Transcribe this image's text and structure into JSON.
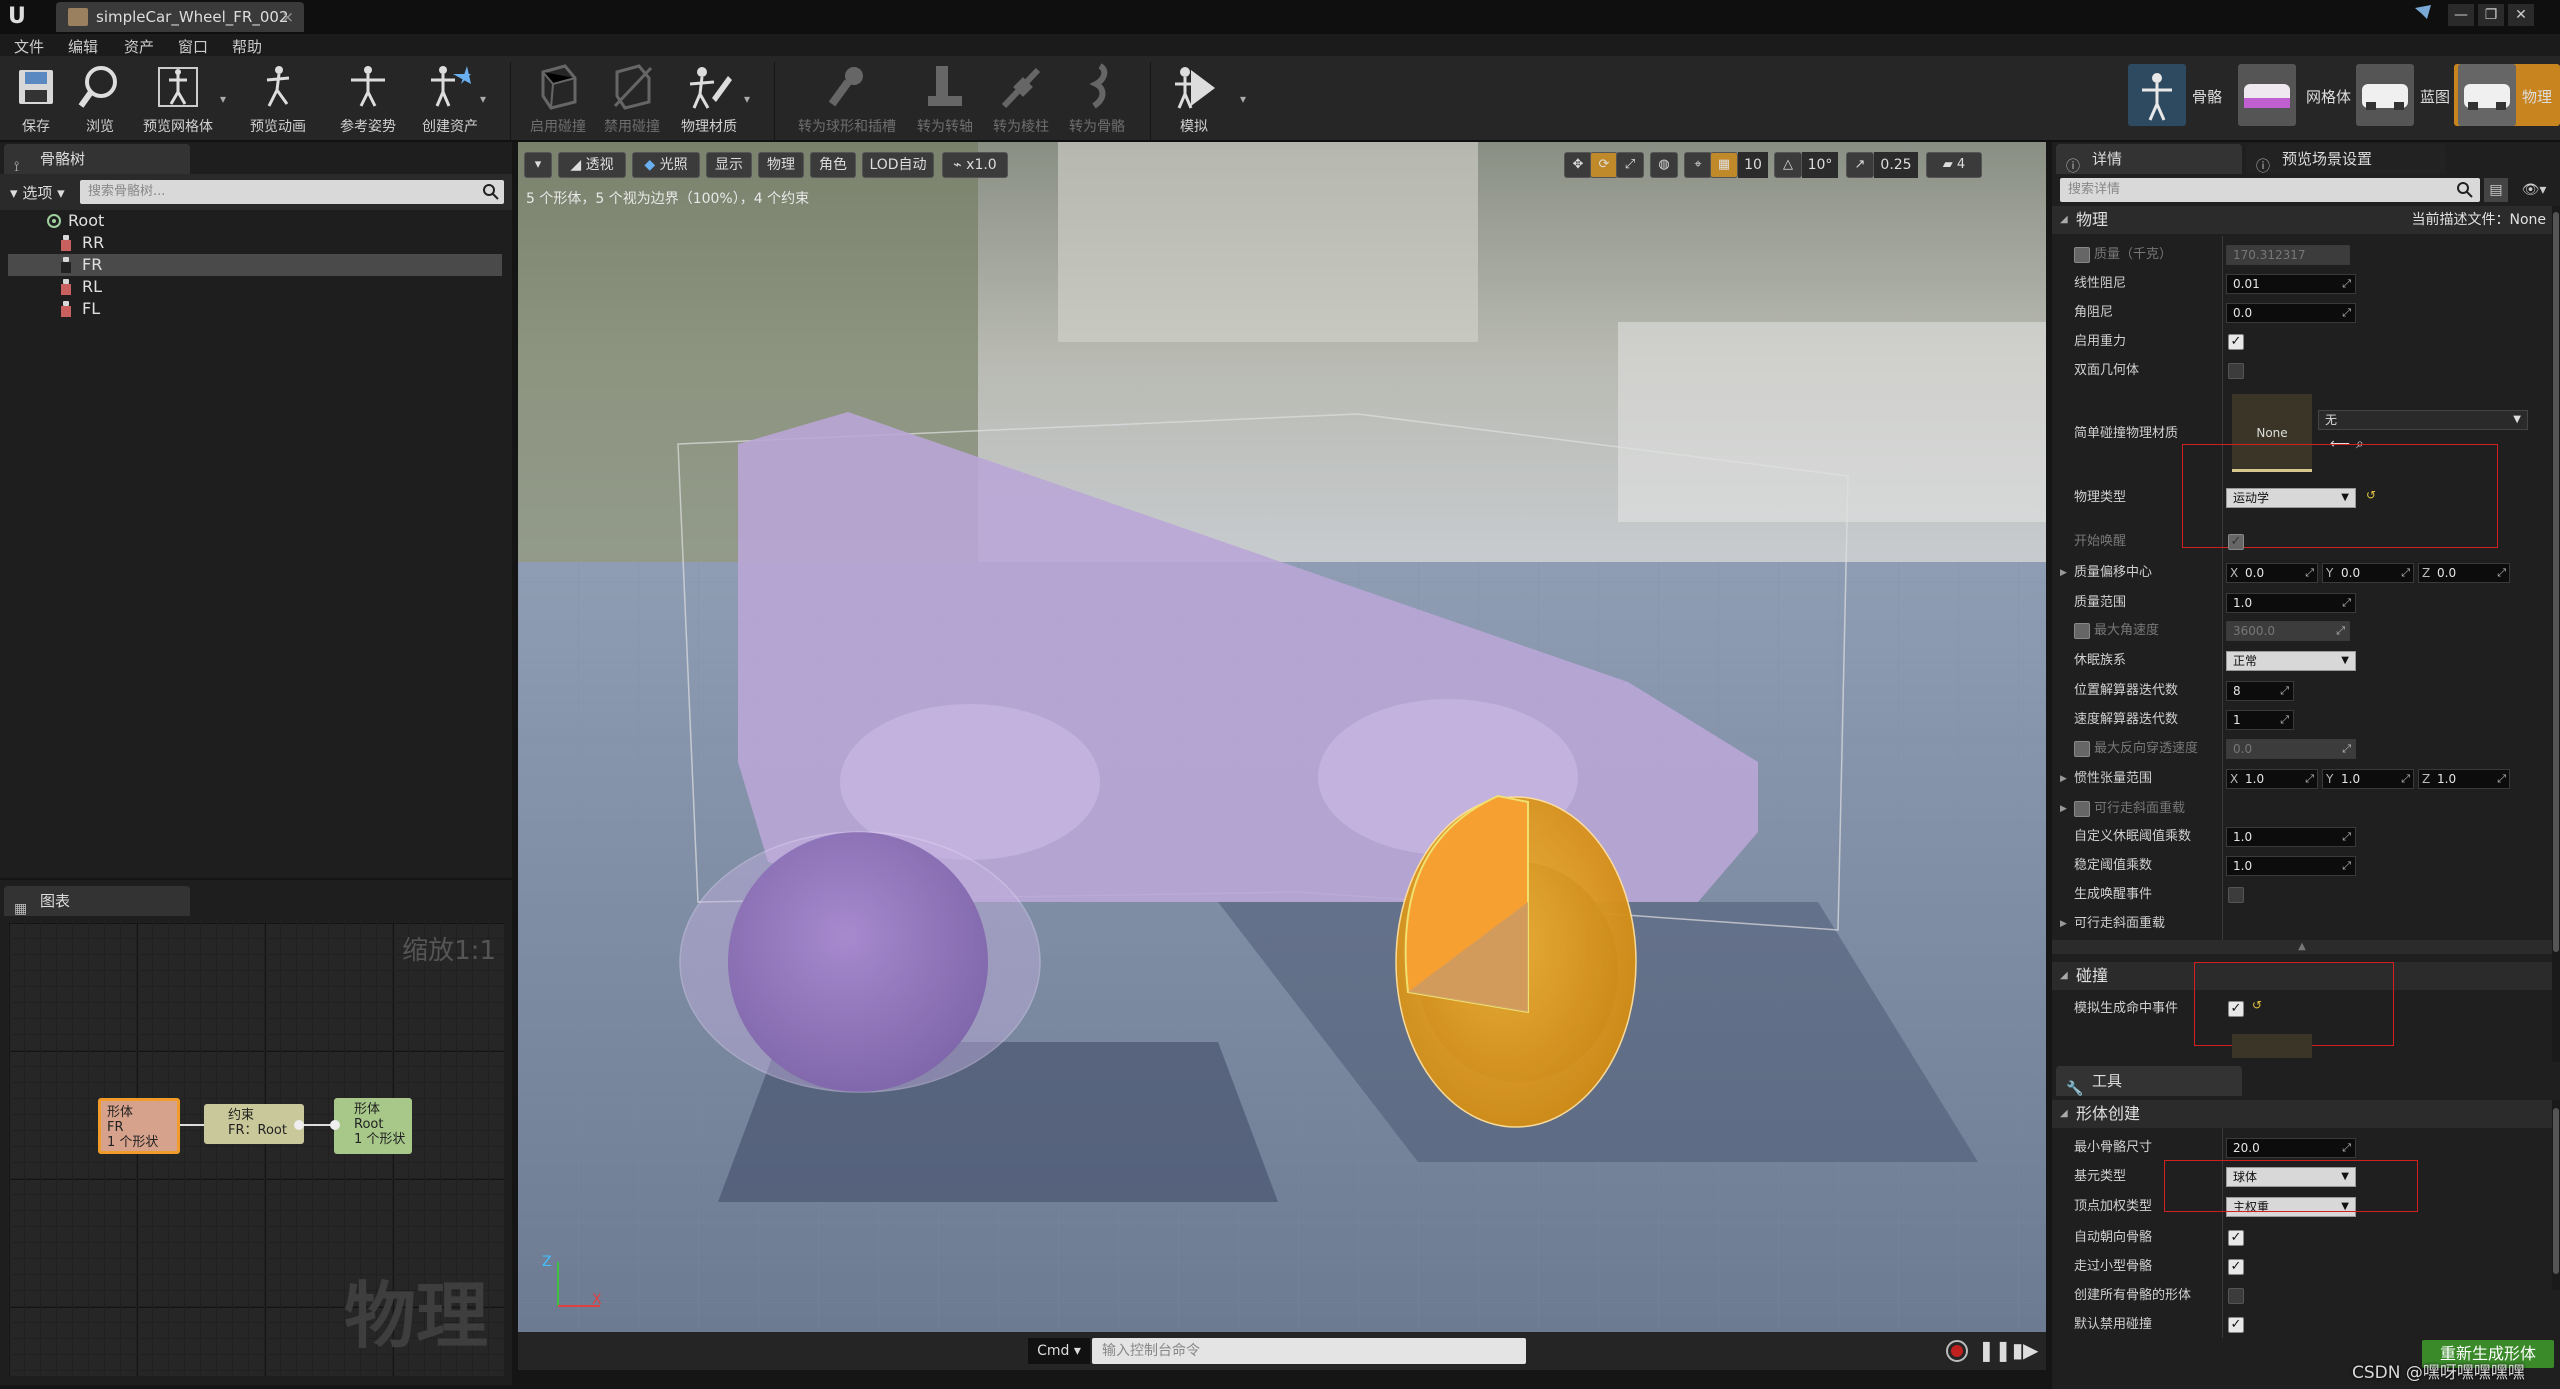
{
  "window": {
    "logo": "U",
    "tab_title": "simpleCar_Wheel_FR_002",
    "tab_close": "×",
    "controls": [
      "—",
      "❐",
      "✕"
    ]
  },
  "menu": [
    "文件",
    "编辑",
    "资产",
    "窗口",
    "帮助"
  ],
  "toolbar": {
    "buttons": [
      {
        "label": "保存",
        "icon": "save-icon"
      },
      {
        "label": "浏览",
        "icon": "browse-icon"
      },
      {
        "label": "预览网格体",
        "icon": "preview-mesh-icon"
      },
      {
        "label": "预览动画",
        "icon": "preview-animation-icon"
      },
      {
        "label": "参考姿势",
        "icon": "reference-pose-icon"
      },
      {
        "label": "创建资产",
        "icon": "create-asset-icon"
      },
      {
        "label": "启用碰撞",
        "icon": "enable-collision-icon"
      },
      {
        "label": "禁用碰撞",
        "icon": "disable-collision-icon"
      },
      {
        "label": "物理材质",
        "icon": "physical-material-icon"
      },
      {
        "label": "转为球形和插槽",
        "icon": "convert-to-ballsocket-icon"
      },
      {
        "label": "转为转轴",
        "icon": "convert-to-hinge-icon"
      },
      {
        "label": "转为棱柱",
        "icon": "convert-to-prismatic-icon"
      },
      {
        "label": "转为骨骼",
        "icon": "convert-to-skeletal-icon"
      },
      {
        "label": "模拟",
        "icon": "simulate-icon"
      }
    ],
    "modes": [
      {
        "label": "骨骼",
        "icon": "skeleton-mode-icon"
      },
      {
        "label": "网格体",
        "icon": "mesh-mode-icon"
      },
      {
        "label": "蓝图",
        "icon": "blueprint-mode-icon"
      },
      {
        "label": "物理",
        "icon": "physics-mode-icon"
      }
    ]
  },
  "skeleton_tree": {
    "tab": "骨骼树",
    "options_label": "选项",
    "search_placeholder": "搜索骨骼树...",
    "root": "Root",
    "bones": [
      "RR",
      "FR",
      "RL",
      "FL"
    ],
    "selected": "FR"
  },
  "graph": {
    "tab": "图表",
    "zoom_label": "缩放1:1",
    "watermark": "物理",
    "nodes": [
      {
        "line1": "形体",
        "line2": "FR",
        "line3": "1 个形状"
      },
      {
        "line1": "约束",
        "line2": "FR：Root",
        "line3": ""
      },
      {
        "line1": "形体",
        "line2": "Root",
        "line3": "1 个形状"
      }
    ]
  },
  "viewport": {
    "buttons": [
      "透视",
      "光照",
      "显示",
      "物理",
      "角色",
      "LOD自动",
      "x1.0"
    ],
    "stats": "5 个形体，5 个视为边界（100%），4 个约束",
    "grid_snap": "10",
    "rotation_snap": "10°",
    "scale_snap": "0.25",
    "camera_speed": "4",
    "console_label": "Cmd",
    "console_placeholder": "输入控制台命令",
    "axis_z": "Z",
    "axis_x": "X"
  },
  "details": {
    "tab1": "详情",
    "tab2": "预览场景设置",
    "search_placeholder": "搜索详情",
    "physics_section": "物理",
    "profile_label": "当前描述文件：None",
    "mass_label": "质量（千克）",
    "mass_value": "170.312317",
    "linear_damping_label": "线性阻尼",
    "linear_damping_value": "0.01",
    "angular_damping_label": "角阻尼",
    "angular_damping_value": "0.0",
    "enable_gravity_label": "启用重力",
    "double_sided_label": "双面几何体",
    "simple_phys_mat_label": "简单碰撞物理材质",
    "phys_mat_thumb": "None",
    "phys_mat_combo": "无",
    "physics_type_label": "物理类型",
    "physics_type_value": "运动学",
    "start_awake_label": "开始唤醒",
    "com_offset_label": "质量偏移中心",
    "com_x": "0.0",
    "com_y": "0.0",
    "com_z": "0.0",
    "mass_scale_label": "质量范围",
    "mass_scale_value": "1.0",
    "max_ang_vel_label": "最大角速度",
    "max_ang_vel_value": "3600.0",
    "sleep_family_label": "休眠族系",
    "sleep_family_value": "正常",
    "pos_iter_label": "位置解算器迭代数",
    "pos_iter_value": "8",
    "vel_iter_label": "速度解算器迭代数",
    "vel_iter_value": "1",
    "max_depen_label": "最大反向穿透速度",
    "max_depen_value": "0.0",
    "inertia_label": "惯性张量范围",
    "inertia_x": "1.0",
    "inertia_y": "1.0",
    "inertia_z": "1.0",
    "walkable_override_label": "可行走斜面重载",
    "custom_sleep_label": "自定义休眠阈值乘数",
    "custom_sleep_value": "1.0",
    "stab_thresh_label": "稳定阈值乘数",
    "stab_thresh_value": "1.0",
    "wake_events_label": "生成唤醒事件",
    "walkable_label": "可行走斜面重载",
    "collision_section": "碰撞",
    "sim_hit_label": "模拟生成命中事件",
    "axis_x": "X",
    "axis_y": "Y",
    "axis_z": "Z"
  },
  "tools": {
    "tab": "工具",
    "section": "形体创建",
    "min_bone_label": "最小骨骼尺寸",
    "min_bone_value": "20.0",
    "prim_type_label": "基元类型",
    "prim_type_value": "球体",
    "vert_weight_label": "顶点加权类型",
    "vert_weight_value": "主权重",
    "auto_orient_label": "自动朝向骨骼",
    "walk_past_label": "走过小型骨骼",
    "create_all_label": "创建所有骨骼的形体",
    "disable_coll_label": "默认禁用碰撞",
    "regen_button": "重新生成形体"
  },
  "watermark_text": "CSDN @嘿呀嘿嘿嘿嘿"
}
